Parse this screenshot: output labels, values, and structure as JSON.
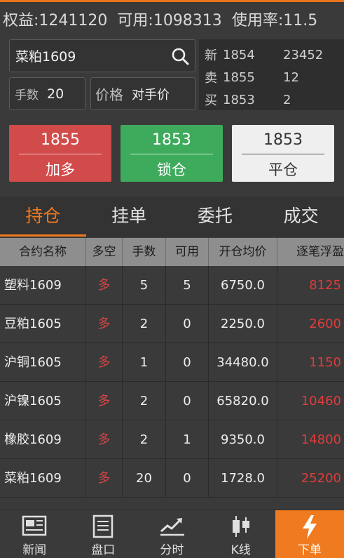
{
  "account": {
    "equity_label": "权益:1241120",
    "available_label": "可用:1098313",
    "usage_label": "使用率:11.5"
  },
  "order": {
    "contract": "菜粕1609",
    "qty_label": "手数",
    "qty_value": "20",
    "price_label": "价格",
    "price_value": "对手价"
  },
  "quote": {
    "rows": [
      {
        "k": "新",
        "p": "1854",
        "v": "23452"
      },
      {
        "k": "卖",
        "p": "1855",
        "v": "12"
      },
      {
        "k": "买",
        "p": "1853",
        "v": "2"
      }
    ]
  },
  "actions": {
    "buy": {
      "price": "1855",
      "label": "加多"
    },
    "lock": {
      "price": "1853",
      "label": "锁仓"
    },
    "close": {
      "price": "1853",
      "label": "平仓"
    }
  },
  "tabs": [
    "持仓",
    "挂单",
    "委托",
    "成交"
  ],
  "table": {
    "headers": [
      "合约名称",
      "多空",
      "手数",
      "可用",
      "开仓均价",
      "逐笔浮盈"
    ],
    "rows": [
      {
        "name": "塑料1609",
        "dir": "多",
        "qty": "5",
        "avail": "5",
        "avg": "6750.0",
        "pl": "8125"
      },
      {
        "name": "豆粕1605",
        "dir": "多",
        "qty": "2",
        "avail": "0",
        "avg": "2250.0",
        "pl": "2600"
      },
      {
        "name": "沪铜1605",
        "dir": "多",
        "qty": "1",
        "avail": "0",
        "avg": "34480.0",
        "pl": "1150"
      },
      {
        "name": "沪镍1605",
        "dir": "多",
        "qty": "2",
        "avail": "0",
        "avg": "65820.0",
        "pl": "10460"
      },
      {
        "name": "橡胶1609",
        "dir": "多",
        "qty": "2",
        "avail": "1",
        "avg": "9350.0",
        "pl": "14800"
      },
      {
        "name": "菜粕1609",
        "dir": "多",
        "qty": "20",
        "avail": "0",
        "avg": "1728.0",
        "pl": "25200"
      }
    ]
  },
  "nav": [
    {
      "label": "新闻",
      "icon": "news-icon"
    },
    {
      "label": "盘口",
      "icon": "order-book-icon"
    },
    {
      "label": "分时",
      "icon": "time-share-icon"
    },
    {
      "label": "K线",
      "icon": "kline-icon"
    },
    {
      "label": "下单",
      "icon": "lightning-icon"
    }
  ],
  "colors": {
    "accent": "#f07a1f",
    "buy": "#d24b4b",
    "lock": "#3eaa5c",
    "close": "#efefef",
    "profit": "#e03c3c"
  }
}
